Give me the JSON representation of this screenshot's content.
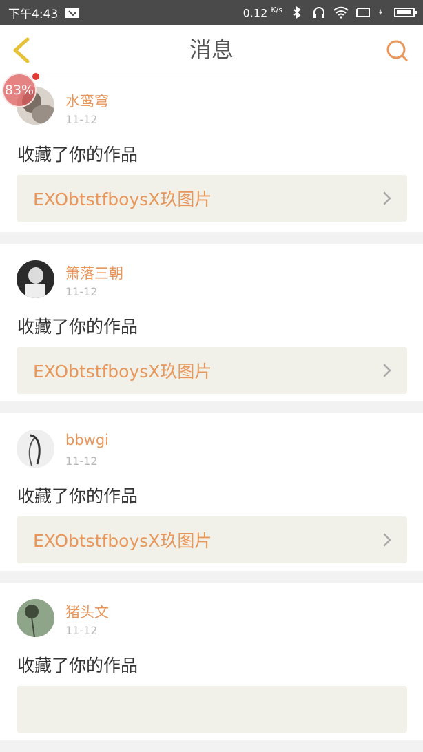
{
  "status_bar": {
    "time": "下午4:43",
    "speed": "0.12",
    "speed_unit": "K/s"
  },
  "header": {
    "title": "消息"
  },
  "messages": [
    {
      "username": "水鸾穹",
      "date": "11-12",
      "action": "收藏了你的作品",
      "work_title": "EXObtstfboysX玖图片"
    },
    {
      "username": "箫落三朝",
      "date": "11-12",
      "action": "收藏了你的作品",
      "work_title": "EXObtstfboysX玖图片"
    },
    {
      "username": "bbwgi",
      "date": "11-12",
      "action": "收藏了你的作品",
      "work_title": "EXObtstfboysX玖图片"
    },
    {
      "username": "猪头文",
      "date": "11-12",
      "action": "收藏了你的作品",
      "work_title": ""
    }
  ],
  "overlay": {
    "badge_text": "83%"
  },
  "colors": {
    "accent": "#e8965a",
    "status_bar": "#4a4a4a",
    "link_bg": "#f1f1ea",
    "back_icon": "#e6c23a"
  },
  "icons": {
    "back": "chevron-left-icon",
    "search": "search-icon",
    "chevron": "chevron-right-icon"
  }
}
